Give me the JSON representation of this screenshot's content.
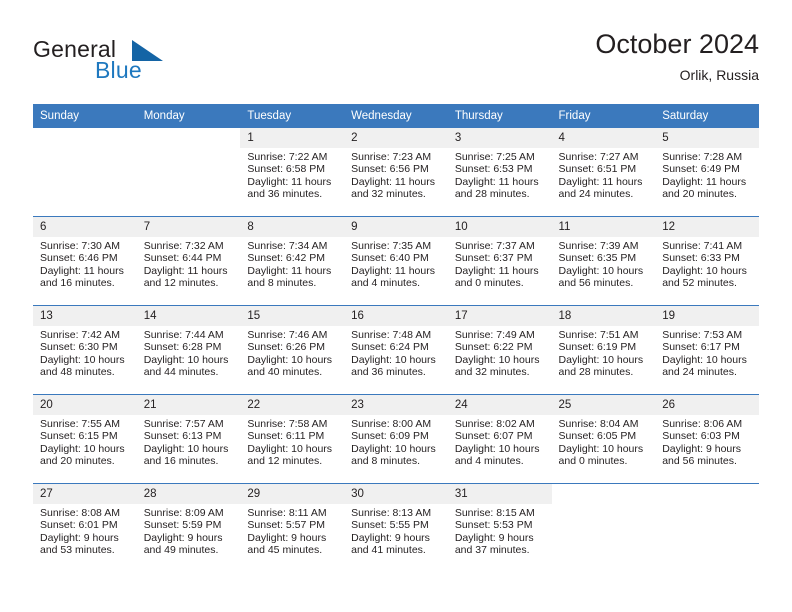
{
  "brand": {
    "word1": "General",
    "word2": "Blue",
    "triangle_icon": "triangle-icon",
    "accent_color": "#1464a5"
  },
  "header": {
    "title": "October 2024",
    "subtitle": "Orlik, Russia"
  },
  "calendar": {
    "header_bg": "#3b79bd",
    "daynum_bg": "#f0f0f0",
    "weekday_headers": [
      "Sunday",
      "Monday",
      "Tuesday",
      "Wednesday",
      "Thursday",
      "Friday",
      "Saturday"
    ],
    "weeks": [
      [
        {
          "day": "",
          "sunrise": "",
          "sunset": "",
          "daylight": "",
          "blank": true
        },
        {
          "day": "",
          "sunrise": "",
          "sunset": "",
          "daylight": "",
          "blank": true
        },
        {
          "day": "1",
          "sunrise": "Sunrise: 7:22 AM",
          "sunset": "Sunset: 6:58 PM",
          "daylight": "Daylight: 11 hours and 36 minutes."
        },
        {
          "day": "2",
          "sunrise": "Sunrise: 7:23 AM",
          "sunset": "Sunset: 6:56 PM",
          "daylight": "Daylight: 11 hours and 32 minutes."
        },
        {
          "day": "3",
          "sunrise": "Sunrise: 7:25 AM",
          "sunset": "Sunset: 6:53 PM",
          "daylight": "Daylight: 11 hours and 28 minutes."
        },
        {
          "day": "4",
          "sunrise": "Sunrise: 7:27 AM",
          "sunset": "Sunset: 6:51 PM",
          "daylight": "Daylight: 11 hours and 24 minutes."
        },
        {
          "day": "5",
          "sunrise": "Sunrise: 7:28 AM",
          "sunset": "Sunset: 6:49 PM",
          "daylight": "Daylight: 11 hours and 20 minutes."
        }
      ],
      [
        {
          "day": "6",
          "sunrise": "Sunrise: 7:30 AM",
          "sunset": "Sunset: 6:46 PM",
          "daylight": "Daylight: 11 hours and 16 minutes."
        },
        {
          "day": "7",
          "sunrise": "Sunrise: 7:32 AM",
          "sunset": "Sunset: 6:44 PM",
          "daylight": "Daylight: 11 hours and 12 minutes."
        },
        {
          "day": "8",
          "sunrise": "Sunrise: 7:34 AM",
          "sunset": "Sunset: 6:42 PM",
          "daylight": "Daylight: 11 hours and 8 minutes."
        },
        {
          "day": "9",
          "sunrise": "Sunrise: 7:35 AM",
          "sunset": "Sunset: 6:40 PM",
          "daylight": "Daylight: 11 hours and 4 minutes."
        },
        {
          "day": "10",
          "sunrise": "Sunrise: 7:37 AM",
          "sunset": "Sunset: 6:37 PM",
          "daylight": "Daylight: 11 hours and 0 minutes."
        },
        {
          "day": "11",
          "sunrise": "Sunrise: 7:39 AM",
          "sunset": "Sunset: 6:35 PM",
          "daylight": "Daylight: 10 hours and 56 minutes."
        },
        {
          "day": "12",
          "sunrise": "Sunrise: 7:41 AM",
          "sunset": "Sunset: 6:33 PM",
          "daylight": "Daylight: 10 hours and 52 minutes."
        }
      ],
      [
        {
          "day": "13",
          "sunrise": "Sunrise: 7:42 AM",
          "sunset": "Sunset: 6:30 PM",
          "daylight": "Daylight: 10 hours and 48 minutes."
        },
        {
          "day": "14",
          "sunrise": "Sunrise: 7:44 AM",
          "sunset": "Sunset: 6:28 PM",
          "daylight": "Daylight: 10 hours and 44 minutes."
        },
        {
          "day": "15",
          "sunrise": "Sunrise: 7:46 AM",
          "sunset": "Sunset: 6:26 PM",
          "daylight": "Daylight: 10 hours and 40 minutes."
        },
        {
          "day": "16",
          "sunrise": "Sunrise: 7:48 AM",
          "sunset": "Sunset: 6:24 PM",
          "daylight": "Daylight: 10 hours and 36 minutes."
        },
        {
          "day": "17",
          "sunrise": "Sunrise: 7:49 AM",
          "sunset": "Sunset: 6:22 PM",
          "daylight": "Daylight: 10 hours and 32 minutes."
        },
        {
          "day": "18",
          "sunrise": "Sunrise: 7:51 AM",
          "sunset": "Sunset: 6:19 PM",
          "daylight": "Daylight: 10 hours and 28 minutes."
        },
        {
          "day": "19",
          "sunrise": "Sunrise: 7:53 AM",
          "sunset": "Sunset: 6:17 PM",
          "daylight": "Daylight: 10 hours and 24 minutes."
        }
      ],
      [
        {
          "day": "20",
          "sunrise": "Sunrise: 7:55 AM",
          "sunset": "Sunset: 6:15 PM",
          "daylight": "Daylight: 10 hours and 20 minutes."
        },
        {
          "day": "21",
          "sunrise": "Sunrise: 7:57 AM",
          "sunset": "Sunset: 6:13 PM",
          "daylight": "Daylight: 10 hours and 16 minutes."
        },
        {
          "day": "22",
          "sunrise": "Sunrise: 7:58 AM",
          "sunset": "Sunset: 6:11 PM",
          "daylight": "Daylight: 10 hours and 12 minutes."
        },
        {
          "day": "23",
          "sunrise": "Sunrise: 8:00 AM",
          "sunset": "Sunset: 6:09 PM",
          "daylight": "Daylight: 10 hours and 8 minutes."
        },
        {
          "day": "24",
          "sunrise": "Sunrise: 8:02 AM",
          "sunset": "Sunset: 6:07 PM",
          "daylight": "Daylight: 10 hours and 4 minutes."
        },
        {
          "day": "25",
          "sunrise": "Sunrise: 8:04 AM",
          "sunset": "Sunset: 6:05 PM",
          "daylight": "Daylight: 10 hours and 0 minutes."
        },
        {
          "day": "26",
          "sunrise": "Sunrise: 8:06 AM",
          "sunset": "Sunset: 6:03 PM",
          "daylight": "Daylight: 9 hours and 56 minutes."
        }
      ],
      [
        {
          "day": "27",
          "sunrise": "Sunrise: 8:08 AM",
          "sunset": "Sunset: 6:01 PM",
          "daylight": "Daylight: 9 hours and 53 minutes."
        },
        {
          "day": "28",
          "sunrise": "Sunrise: 8:09 AM",
          "sunset": "Sunset: 5:59 PM",
          "daylight": "Daylight: 9 hours and 49 minutes."
        },
        {
          "day": "29",
          "sunrise": "Sunrise: 8:11 AM",
          "sunset": "Sunset: 5:57 PM",
          "daylight": "Daylight: 9 hours and 45 minutes."
        },
        {
          "day": "30",
          "sunrise": "Sunrise: 8:13 AM",
          "sunset": "Sunset: 5:55 PM",
          "daylight": "Daylight: 9 hours and 41 minutes."
        },
        {
          "day": "31",
          "sunrise": "Sunrise: 8:15 AM",
          "sunset": "Sunset: 5:53 PM",
          "daylight": "Daylight: 9 hours and 37 minutes."
        },
        {
          "day": "",
          "sunrise": "",
          "sunset": "",
          "daylight": "",
          "blank": true
        },
        {
          "day": "",
          "sunrise": "",
          "sunset": "",
          "daylight": "",
          "blank": true
        }
      ]
    ]
  }
}
